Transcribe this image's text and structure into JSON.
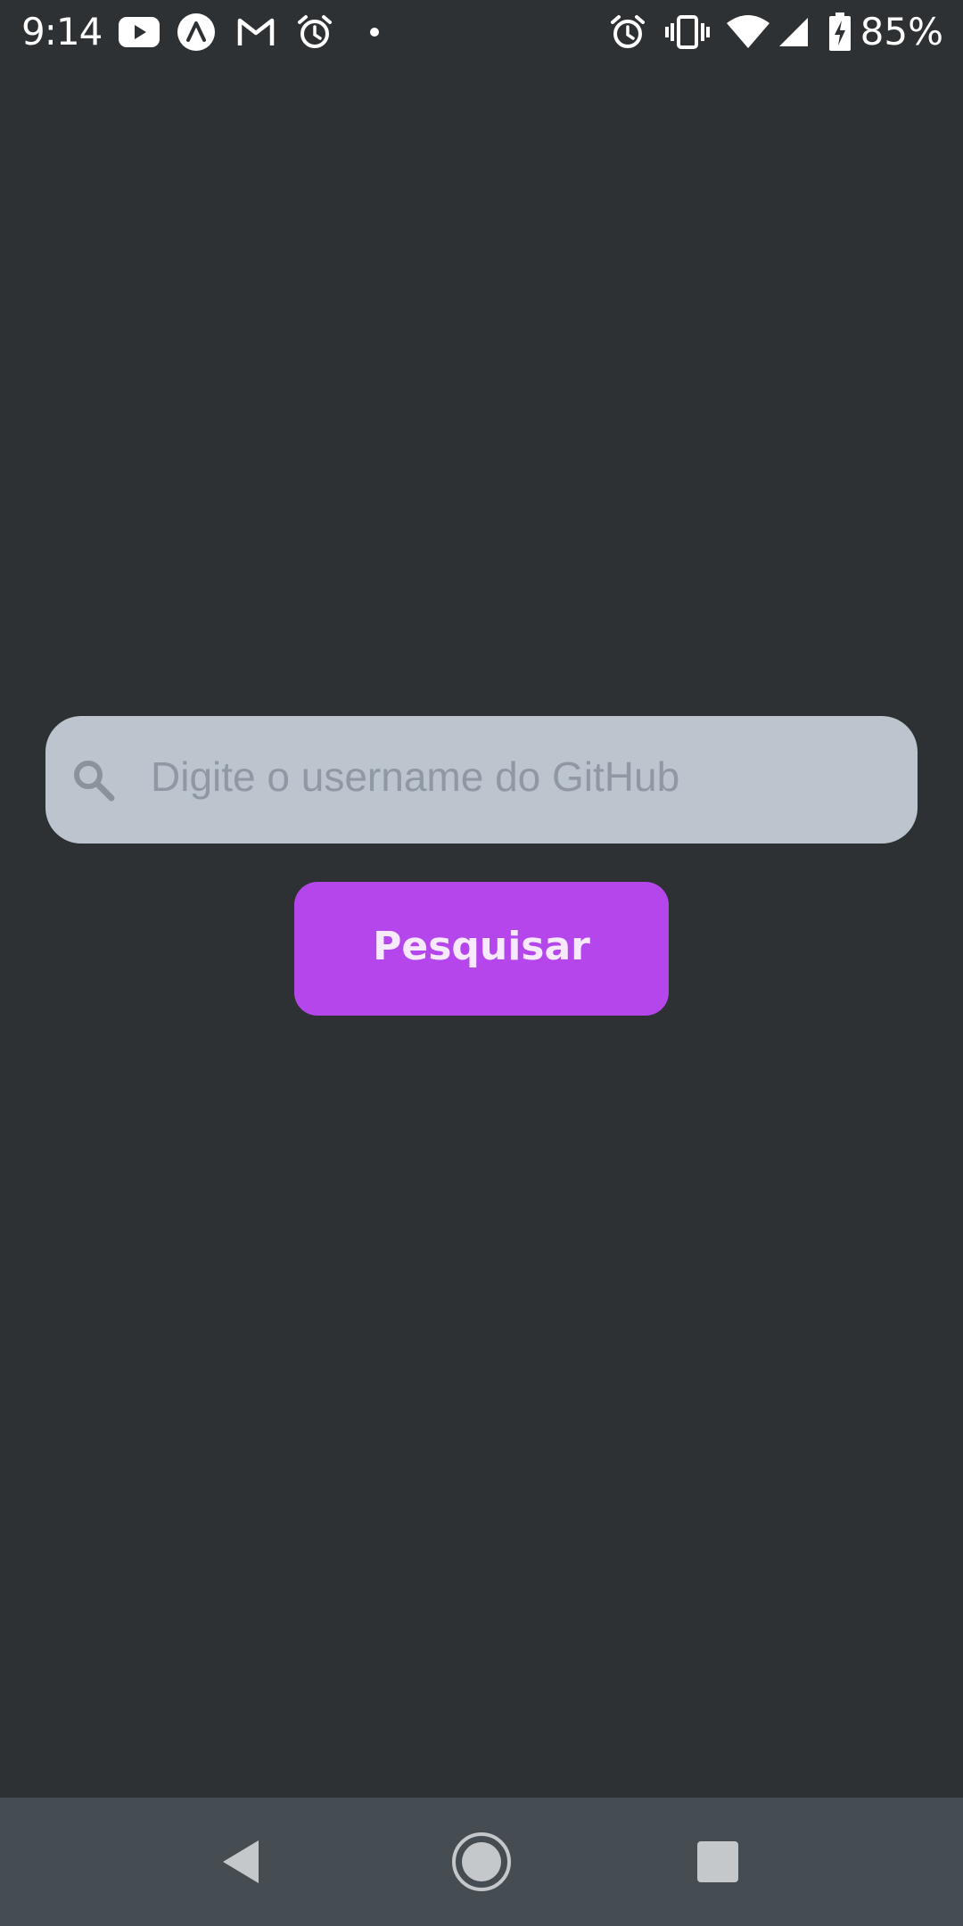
{
  "status_bar": {
    "time": "9:14",
    "battery_percent": "85%",
    "left_icons": [
      "youtube-icon",
      "arc-icon",
      "gmail-icon",
      "alarm-icon",
      "dot-icon"
    ],
    "right_icons": [
      "alarm-icon",
      "vibrate-icon",
      "wifi-icon",
      "signal-icon",
      "battery-charging-icon"
    ]
  },
  "search": {
    "placeholder": "Digite o username do GitHub",
    "value": "",
    "icon": "search-icon"
  },
  "button": {
    "label": "Pesquisar"
  },
  "nav_bar": {
    "buttons": [
      "back-icon",
      "home-icon",
      "recents-icon"
    ]
  },
  "colors": {
    "background": "#2e3133",
    "input_background": "#bcc5ce",
    "placeholder": "#8f98a3",
    "button": "#b546ec",
    "button_text": "#f7eaff",
    "nav_bar": "#454c52"
  }
}
